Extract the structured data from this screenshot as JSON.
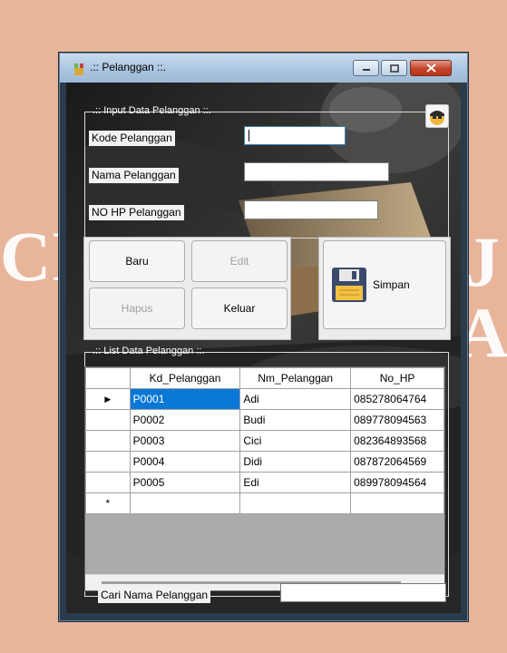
{
  "window": {
    "title": ".:: Pelanggan ::."
  },
  "input_group": {
    "legend": ".:: Input Data Pelanggan ::.",
    "kode_label": "Kode Pelanggan",
    "kode_value": "",
    "nama_label": "Nama Pelanggan",
    "nama_value": "",
    "hp_label": "NO HP Pelanggan",
    "hp_value": ""
  },
  "buttons": {
    "baru": "Baru",
    "edit": "Edit",
    "hapus": "Hapus",
    "keluar": "Keluar",
    "simpan": "Simpan"
  },
  "list_group": {
    "legend": ".:: List Data Pelanggan ::.",
    "columns": [
      "Kd_Pelanggan",
      "Nm_Pelanggan",
      "No_HP"
    ],
    "rows": [
      {
        "kd": "P0001",
        "nm": "Adi",
        "hp": "085278064764"
      },
      {
        "kd": "P0002",
        "nm": "Budi",
        "hp": "089778094563"
      },
      {
        "kd": "P0003",
        "nm": "Cici",
        "hp": "082364893568"
      },
      {
        "kd": "P0004",
        "nm": "Didi",
        "hp": "087872064569"
      },
      {
        "kd": "P0005",
        "nm": "Edi",
        "hp": "089978094564"
      }
    ],
    "current_row_marker": "▶",
    "new_row_marker": "*"
  },
  "search": {
    "label": "Cari Nama Pelanggan",
    "value": ""
  },
  "background": {
    "left_text": "CI",
    "right_text": "J",
    "right_text2": "A"
  },
  "colors": {
    "page_bg": "#e8b59b",
    "selection": "#0a78d7",
    "window_frame": "#2a3b4c"
  }
}
